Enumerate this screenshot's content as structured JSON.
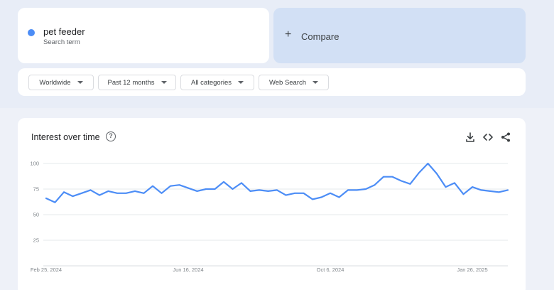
{
  "search_term": {
    "name": "pet feeder",
    "subtitle": "Search term",
    "color": "#4c8df6"
  },
  "compare": {
    "plus": "+",
    "label": "Compare"
  },
  "filters": [
    {
      "label": "Worldwide"
    },
    {
      "label": "Past 12 months"
    },
    {
      "label": "All categories"
    },
    {
      "label": "Web Search"
    }
  ],
  "chart_panel": {
    "title": "Interest over time",
    "help_glyph": "?",
    "icons": [
      "download-icon",
      "embed-code-icon",
      "share-icon"
    ]
  },
  "chart_data": {
    "type": "line",
    "title": "Interest over time",
    "xlabel": "",
    "ylabel": "",
    "ylim": [
      0,
      100
    ],
    "yticks": [
      25,
      50,
      75,
      100
    ],
    "grid": true,
    "x_tick_labels": [
      {
        "label": "Feb 25, 2024",
        "index": 0
      },
      {
        "label": "Jun 16, 2024",
        "index": 16
      },
      {
        "label": "Oct 6, 2024",
        "index": 32
      },
      {
        "label": "Jan 26, 2025",
        "index": 48
      }
    ],
    "series": [
      {
        "color": "#4c8df6",
        "values": [
          66,
          62,
          72,
          68,
          71,
          74,
          69,
          73,
          71,
          71,
          73,
          71,
          78,
          71,
          78,
          79,
          76,
          73,
          75,
          75,
          82,
          75,
          81,
          73,
          74,
          73,
          74,
          69,
          71,
          71,
          65,
          67,
          71,
          67,
          74,
          74,
          75,
          79,
          87,
          87,
          83,
          80,
          91,
          100,
          90,
          77,
          81,
          70,
          77,
          74,
          73,
          72,
          74
        ]
      }
    ]
  }
}
